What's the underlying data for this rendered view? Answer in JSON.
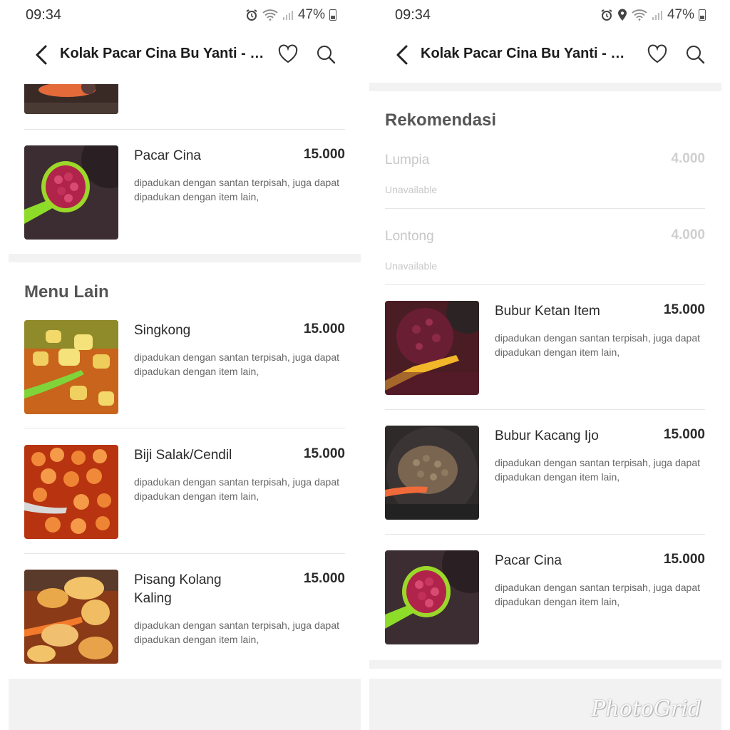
{
  "status_bar_left": {
    "time": "09:34",
    "battery": "47%"
  },
  "status_bar_right": {
    "time": "09:34",
    "battery": "47%"
  },
  "app_bar": {
    "title": "Kolak Pacar Cina Bu Yanti - Ta..."
  },
  "left_panel": {
    "top_item": {
      "name": "Pacar Cina",
      "price": "15.000",
      "description": "dipadukan dengan santan terpisah, juga dapat dipadukan dengan item lain,"
    },
    "section_title": "Menu Lain",
    "items": [
      {
        "name": "Singkong",
        "price": "15.000",
        "description": "dipadukan dengan santan terpisah, juga dapat dipadukan dengan item lain,"
      },
      {
        "name": "Biji Salak/Cendil",
        "price": "15.000",
        "description": "dipadukan dengan santan terpisah, juga dapat dipadukan dengan item lain,"
      },
      {
        "name": "Pisang Kolang Kaling",
        "price": "15.000",
        "description": "dipadukan dengan santan terpisah, juga dapat dipadukan dengan item lain,"
      }
    ]
  },
  "right_panel": {
    "section_title": "Rekomendasi",
    "unavailable_items": [
      {
        "name": "Lumpia",
        "price": "4.000",
        "status": "Unavailable"
      },
      {
        "name": "Lontong",
        "price": "4.000",
        "status": "Unavailable"
      }
    ],
    "items": [
      {
        "name": "Bubur Ketan Item",
        "price": "15.000",
        "description": "dipadukan dengan santan terpisah, juga dapat dipadukan dengan item lain,"
      },
      {
        "name": "Bubur Kacang Ijo",
        "price": "15.000",
        "description": "dipadukan dengan santan terpisah, juga dapat dipadukan dengan item lain,"
      },
      {
        "name": "Pacar Cina",
        "price": "15.000",
        "description": "dipadukan dengan santan terpisah, juga dapat dipadukan dengan item lain,"
      }
    ]
  },
  "watermark": "PhotoGrid",
  "colors": {
    "divider": "#f2f2f2",
    "text_dark": "#2a2a2a",
    "text_muted": "#666666",
    "unavailable": "#c8c8c8"
  }
}
